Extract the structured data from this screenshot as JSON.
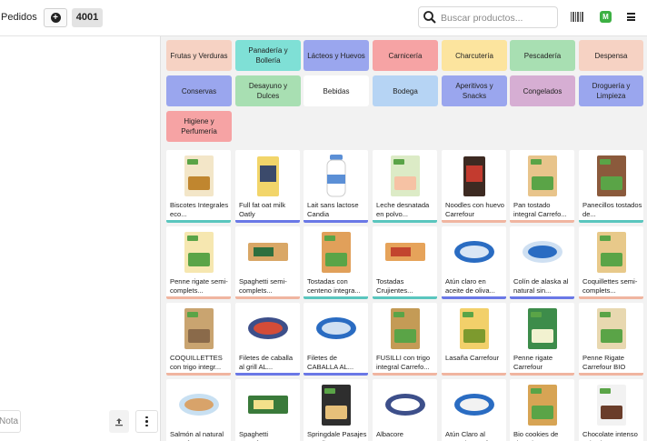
{
  "header": {
    "title": "Pedidos",
    "order_number": "4001",
    "user_initial": "M"
  },
  "search": {
    "placeholder": "Buscar productos..."
  },
  "left_panel": {
    "note_label": "Nota"
  },
  "colors": {
    "frutas": "#f6d2c3",
    "panaderia": "#7fe0d6",
    "lacteos": "#9aa6ee",
    "carniceria": "#f6a3a4",
    "charcuteria": "#fce49e",
    "pescaderia": "#a8dfb2",
    "despensa": "#f6d2c3",
    "conservas": "#9aa6ee",
    "desayuno": "#a8dfb2",
    "bebidas": "#ffffff",
    "bodega": "#b6d4f4",
    "aperitivos": "#9aa6ee",
    "congelados": "#d6aed3",
    "drogueria": "#9aa6ee",
    "higiene": "#f6a3a4",
    "bar_despensa": "#f0b5a0",
    "bar_bebidas": "#6a78e6",
    "bar_desayuno": "#5ac6be"
  },
  "categories": [
    "Frutas y Verduras",
    "Panadería y Bollería",
    "Lácteos y Huevos",
    "Carnicería",
    "Charcutería",
    "Pescadería",
    "Despensa",
    "Conservas",
    "Desayuno y Dulces",
    "Bebidas",
    "Bodega",
    "Aperitivos y Snacks",
    "Congelados",
    "Droguería y Limpieza",
    "Higiene y Perfumería"
  ],
  "products": [
    {
      "name": "Biscotes Integrales eco...",
      "icon": "biscuit-box-icon"
    },
    {
      "name": "Full fat oat milk Oatly",
      "icon": "oat-milk-carton-icon"
    },
    {
      "name": "Lait sans lactose Candia",
      "icon": "milk-bottle-icon"
    },
    {
      "name": "Leche desnatada en polvo...",
      "icon": "milk-powder-box-icon"
    },
    {
      "name": "Noodles con huevo Carrefour",
      "icon": "noodles-pack-icon"
    },
    {
      "name": "Pan tostado integral Carrefo...",
      "icon": "toast-pack-icon"
    },
    {
      "name": "Panecillos tostados de...",
      "icon": "panecillos-pack-icon"
    },
    {
      "name": "Penne rigate semi-complets...",
      "icon": "pasta-bag-icon"
    },
    {
      "name": "Spaghetti semi-complets...",
      "icon": "spaghetti-pack-icon"
    },
    {
      "name": "Tostadas con centeno integra...",
      "icon": "tostadas-box-icon"
    },
    {
      "name": "Tostadas Crujientes...",
      "icon": "tostadas-box-icon"
    },
    {
      "name": "Atún claro en aceite de oliva...",
      "icon": "tuna-can-icon"
    },
    {
      "name": "Colín de alaska al natural sin...",
      "icon": "fish-can-icon"
    },
    {
      "name": "Coquillettes semi-complets...",
      "icon": "pasta-bag-icon"
    },
    {
      "name": "COQUILLETTES con trigo integr...",
      "icon": "pasta-bag-icon"
    },
    {
      "name": "Filetes de caballa al grill AL...",
      "icon": "mackerel-tin-icon"
    },
    {
      "name": "Filetes de CABALLA AL...",
      "icon": "mackerel-tin-icon"
    },
    {
      "name": "FUSILLI con trigo integral Carrefo...",
      "icon": "fusilli-box-icon"
    },
    {
      "name": "Lasaña Carrefour",
      "icon": "lasagna-box-icon"
    },
    {
      "name": "Penne rigate Carrefour",
      "icon": "penne-bag-icon"
    },
    {
      "name": "Penne Rigate Carrefour BIO",
      "icon": "penne-bag-icon"
    },
    {
      "name": "Salmón al natural Carrefour...",
      "icon": "salmon-can-icon"
    },
    {
      "name": "Spaghetti Carrefour BIO",
      "icon": "spaghetti-pack-icon"
    },
    {
      "name": "Springdale Pasajes Candia...",
      "icon": "pack-icon"
    },
    {
      "name": "Albacore KIKKALAND...",
      "icon": "tin-icon"
    },
    {
      "name": "Atún Claro al natural Carrefour...",
      "icon": "tuna-can-icon"
    },
    {
      "name": "Bio cookies de chocolate...",
      "icon": "cookies-pack-icon"
    },
    {
      "name": "Chocolate intenso Cristal BIO...",
      "icon": "chocolate-box-icon"
    }
  ]
}
